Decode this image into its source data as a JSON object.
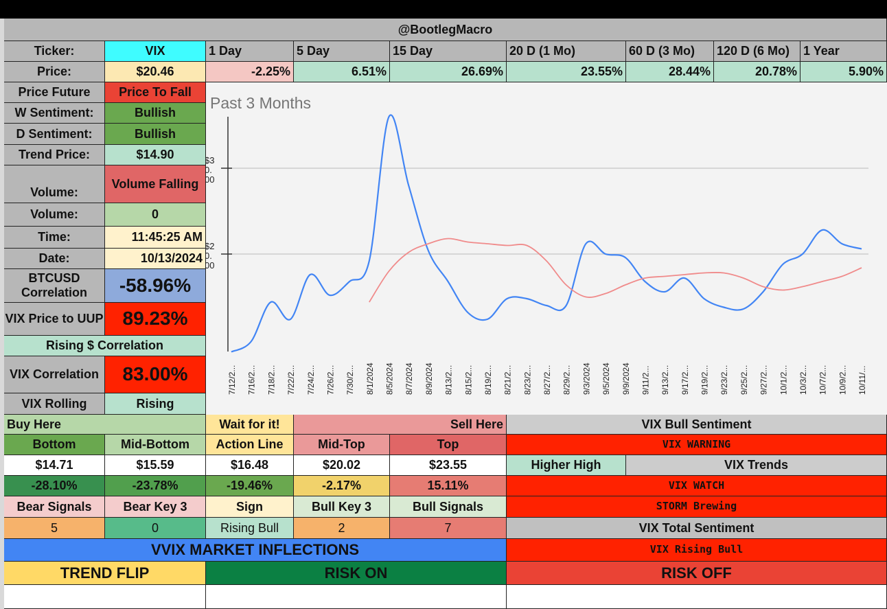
{
  "header": {
    "title": "@BootlegMacro"
  },
  "ticker": {
    "label": "Ticker:",
    "value": "VIX"
  },
  "periods": [
    "1 Day",
    "5 Day",
    "15 Day",
    "20 D (1 Mo)",
    "60 D (3 Mo)",
    "120 D (6 Mo)",
    "1 Year"
  ],
  "price": {
    "label": "Price:",
    "value": "$20.46",
    "changes": [
      "-2.25%",
      "6.51%",
      "26.69%",
      "23.55%",
      "28.44%",
      "20.78%",
      "5.90%"
    ]
  },
  "left": {
    "price_future": {
      "label": "Price Future",
      "value": "Price To Fall"
    },
    "w_sentiment": {
      "label": "W Sentiment:",
      "value": "Bullish"
    },
    "d_sentiment": {
      "label": "D Sentiment:",
      "value": "Bullish"
    },
    "trend_price": {
      "label": "Trend Price:",
      "value": "$14.90"
    },
    "volume_trend": {
      "label": "Volume:",
      "value": "Volume Falling"
    },
    "volume": {
      "label": "Volume:",
      "value": "0"
    },
    "time": {
      "label": "Time:",
      "value": "11:45:25 AM"
    },
    "date": {
      "label": "Date:",
      "value": "10/13/2024"
    },
    "btcusd": {
      "label": "BTCUSD Correlation",
      "value": "-58.96%"
    },
    "uup": {
      "label": "VIX Price to UUP",
      "value": "89.23%"
    },
    "rising_corr": "Rising $ Correlation",
    "vix_corr": {
      "label": "VIX Correlation",
      "value": "83.00%"
    },
    "vix_rolling": {
      "label": "VIX Rolling",
      "value": "Rising"
    }
  },
  "zones": {
    "buy_here": "Buy Here",
    "wait": "Wait for it!",
    "sell_here": "Sell Here",
    "headers": [
      "Bottom",
      "Mid-Bottom",
      "Action Line",
      "Mid-Top",
      "Top"
    ],
    "prices": [
      "$14.71",
      "$15.59",
      "$16.48",
      "$20.02",
      "$23.55"
    ],
    "pcts": [
      "-28.10%",
      "-23.78%",
      "-19.46%",
      "-2.17%",
      "15.11%"
    ],
    "signal_headers": [
      "Bear Signals",
      "Bear Key 3",
      "Sign",
      "Bull Key 3",
      "Bull Signals"
    ],
    "signal_values": [
      "5",
      "0",
      "Rising Bull",
      "2",
      "7"
    ]
  },
  "vvix": {
    "title": "VVIX MARKET INFLECTIONS",
    "trend_flip": "TREND FLIP",
    "risk_on": "RISK ON",
    "risk_off": "RISK OFF"
  },
  "right": {
    "bull_sentiment": "VIX Bull Sentiment",
    "warning": "VIX WARNING",
    "higher_high": "Higher High",
    "trends": "VIX Trends",
    "watch": "VIX WATCH",
    "storm": "STORM Brewing",
    "total_sentiment": "VIX Total Sentiment",
    "rising_bull": "VIX Rising Bull"
  },
  "colors": {
    "cyan": "#3ffcff",
    "gray": "#b7b7b7",
    "red": "#ea4335",
    "green": "#6aa84f",
    "mint": "#b7e1cd",
    "bright_red": "#ff2200",
    "blue": "#4285f4",
    "series_blue": "#4285f4",
    "series_red": "#f08a8a"
  },
  "chart_data": {
    "type": "line",
    "title": "Past 3 Months",
    "ylim": [
      8.6,
      36
    ],
    "yticks": [
      "$30.00",
      "$20.00"
    ],
    "ytick_values": [
      30,
      20
    ],
    "grid": true,
    "categories": [
      "7/12/2...",
      "7/16/2...",
      "7/18/2...",
      "7/22/2...",
      "7/24/2...",
      "7/26/2...",
      "7/30/2...",
      "8/1/2024",
      "8/5/2024",
      "8/7/2024",
      "8/9/2024",
      "8/13/2...",
      "8/15/2...",
      "8/19/2...",
      "8/21/2...",
      "8/23/2...",
      "8/27/2...",
      "8/29/2...",
      "9/3/2024",
      "9/5/2024",
      "9/9/2024",
      "9/11/2...",
      "9/13/2...",
      "9/17/2...",
      "9/19/2...",
      "9/23/2...",
      "9/25/2...",
      "9/27/2...",
      "10/1/2...",
      "10/3/2...",
      "10/7/2...",
      "10/9/2...",
      "10/11/..."
    ],
    "series": [
      {
        "values": [
          8.6,
          9.8,
          14.4,
          12.4,
          17.6,
          15.2,
          16.8,
          19.2,
          36,
          28,
          20.4,
          16.8,
          13.2,
          12.4,
          14.8,
          14.8,
          14,
          14,
          21.2,
          20,
          19.6,
          16.8,
          15.6,
          17.2,
          14.8,
          13.8,
          13.6,
          15.6,
          18.8,
          20,
          22.8,
          21.2,
          20.6
        ],
        "color": "#4285f4"
      },
      {
        "values": [
          null,
          null,
          null,
          null,
          null,
          null,
          null,
          14.4,
          18,
          20.2,
          21.2,
          21.8,
          21.4,
          21.2,
          21,
          21,
          19.2,
          16.4,
          15,
          15.4,
          16.4,
          17.2,
          17.4,
          17.6,
          17.8,
          17.8,
          17.2,
          16.2,
          15.8,
          16.2,
          16.8,
          17.4,
          18.4
        ],
        "color": "#f08a8a"
      }
    ]
  }
}
